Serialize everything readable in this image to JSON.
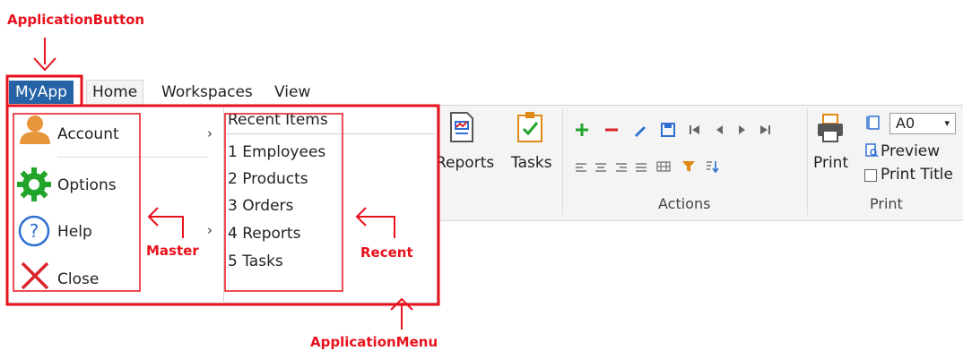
{
  "annotations": {
    "application_button": "ApplicationButton",
    "application_menu": "ApplicationMenu",
    "master": "Master",
    "recent": "Recent",
    "color": "#e8121c"
  },
  "tabs": {
    "app": "MyApp",
    "home": "Home",
    "workspaces": "Workspaces",
    "view": "View"
  },
  "menu": {
    "master_items": [
      {
        "label": "Account",
        "icon": "user-icon",
        "has_submenu": true
      },
      {
        "label": "Options",
        "icon": "gear-icon",
        "has_submenu": false
      },
      {
        "label": "Help",
        "icon": "help-icon",
        "has_submenu": true
      },
      {
        "label": "Close",
        "icon": "close-icon",
        "has_submenu": false
      }
    ],
    "recent_header": "Recent Items",
    "recent_items": [
      "1 Employees",
      "2 Products",
      "3 Orders",
      "4 Reports",
      "5 Tasks"
    ]
  },
  "ribbon": {
    "reports_label": "Reports",
    "tasks_label": "Tasks",
    "actions_group": "Actions",
    "print_group": "Print",
    "print_label": "Print",
    "paper_size": "A0",
    "preview_label": "Preview",
    "print_title_label": "Print Title",
    "print_title_checked": false
  },
  "colors": {
    "app_button_bg": "#2563a6",
    "ribbon_bg": "#f4f4f4",
    "icon_green": "#22a52a",
    "icon_red": "#d9242a",
    "icon_blue": "#2e6fd1",
    "icon_orange": "#e08a16"
  }
}
